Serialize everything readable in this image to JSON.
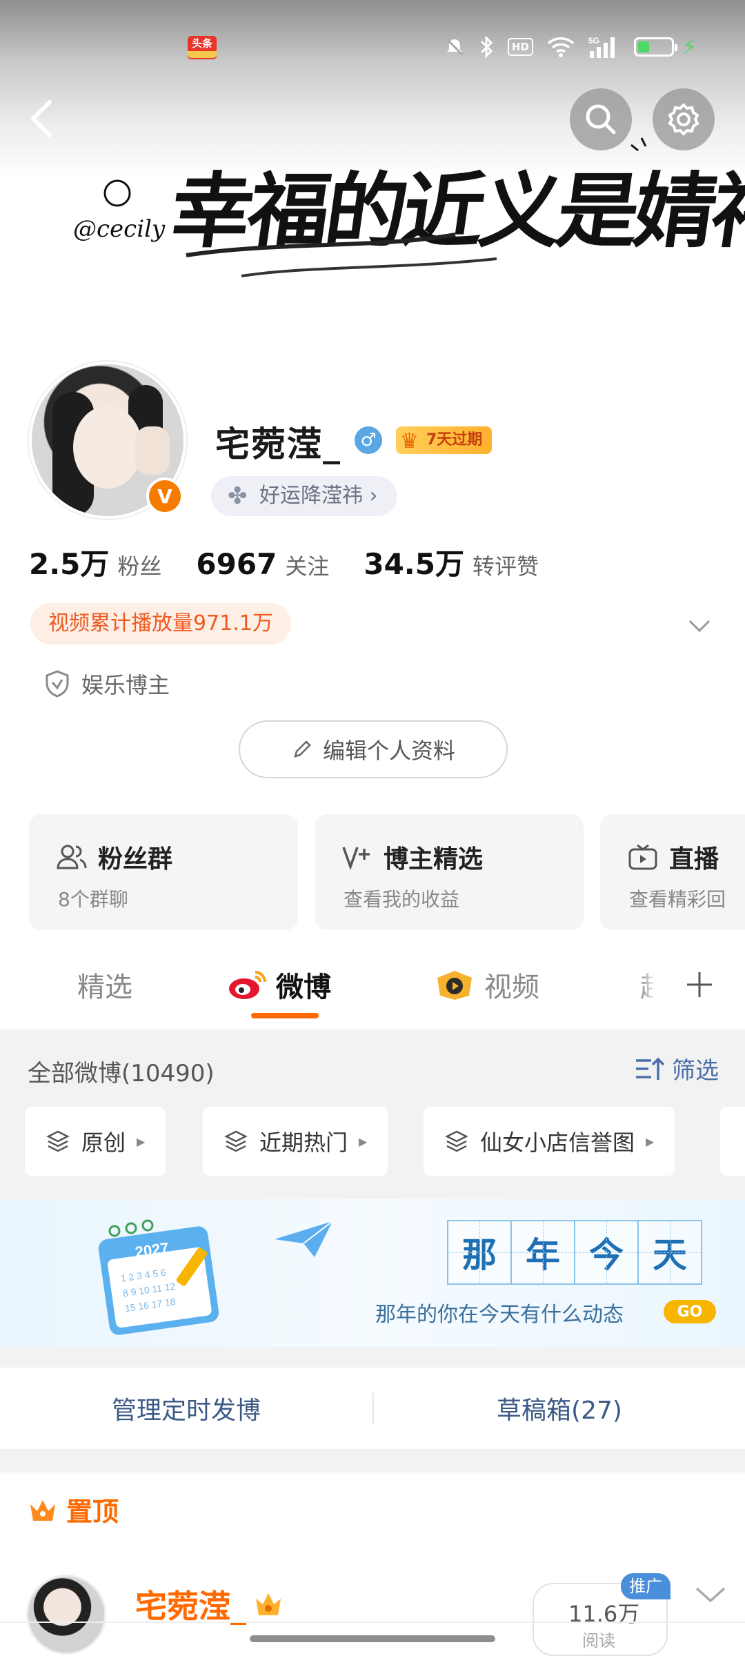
{
  "status_bar": {
    "app_badge": "头条",
    "icons": [
      "mute-icon",
      "bluetooth-icon",
      "hd-icon",
      "wifi-icon",
      "5g-signal-icon",
      "battery-icon",
      "charging-icon"
    ],
    "hd": "HD",
    "network": "5G"
  },
  "header": {
    "banner_handle": "@cecily",
    "banner_text": "幸福的近义是婧祎"
  },
  "profile": {
    "username": "宅菀滢_",
    "verified_badge": "V",
    "gender": "♂",
    "vip_badge": "7天过期",
    "signature": "好运降滢祎",
    "stats": [
      {
        "value": "2.5万",
        "label": "粉丝"
      },
      {
        "value": "6967",
        "label": "关注"
      },
      {
        "value": "34.5万",
        "label": "转评赞"
      }
    ],
    "video_plays": "视频累计播放量971.1万",
    "tag": "娱乐博主",
    "edit_button": "编辑个人资料"
  },
  "cards": [
    {
      "title": "粉丝群",
      "subtitle": "8个群聊",
      "icon": "group-icon"
    },
    {
      "title": "博主精选",
      "subtitle": "查看我的收益",
      "icon": "v-plus-icon"
    },
    {
      "title": "直播",
      "subtitle": "查看精彩回",
      "icon": "tv-icon"
    }
  ],
  "tabs": {
    "items": [
      {
        "label": "精选"
      },
      {
        "label": "微博"
      },
      {
        "label": "视频"
      },
      {
        "label": "超"
      }
    ],
    "active_index": 1
  },
  "feed": {
    "count_label": "全部微博(10490)",
    "filter_label": "筛选",
    "chips": [
      "原创",
      "近期热门",
      "仙女小店信誉图"
    ]
  },
  "on_this_day": {
    "chars": [
      "那",
      "年",
      "今",
      "天"
    ],
    "caption": "那年的你在今天有什么动态",
    "go": "GO",
    "calendar_year": "2027"
  },
  "actions": {
    "scheduled": "管理定时发博",
    "drafts": "草稿箱(27)"
  },
  "pinned": {
    "label": "置顶",
    "username": "宅菀滢_",
    "views": "11.6万",
    "views_label": "阅读",
    "promo": "推广"
  },
  "colors": {
    "accent": "#ff6a00",
    "link": "#4a6fa8",
    "vip": "#ffb12e",
    "gender": "#5aa7e6"
  }
}
